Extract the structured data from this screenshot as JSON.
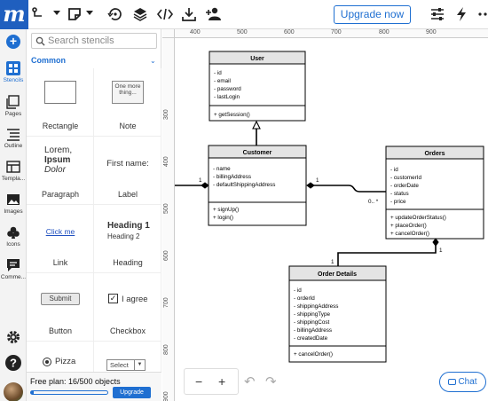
{
  "toolbar": {
    "logo_letter": "m",
    "upgrade_label": "Upgrade now",
    "icons": [
      "logo-icon",
      "connector-icon",
      "note-icon",
      "history-icon",
      "layers-icon",
      "code-icon",
      "download-icon",
      "add-user-icon",
      "settings-sliders-icon",
      "lightning-icon",
      "more-icon"
    ]
  },
  "rail": {
    "items": [
      {
        "label": "Stencils",
        "icon": "stencils-icon"
      },
      {
        "label": "Pages",
        "icon": "pages-icon"
      },
      {
        "label": "Outline",
        "icon": "outline-icon"
      },
      {
        "label": "Templa...",
        "icon": "templates-icon"
      },
      {
        "label": "Images",
        "icon": "images-icon"
      },
      {
        "label": "Icons",
        "icon": "clubs-icon"
      },
      {
        "label": "Comme...",
        "icon": "comments-icon"
      }
    ]
  },
  "stencils": {
    "search_placeholder": "Search stencils",
    "section": "Common",
    "note_text": "One more thing...",
    "paragraph_lines": [
      "Lorem,",
      "Ipsum",
      "Dolor"
    ],
    "label_text": "First name:",
    "link_text": "Click me",
    "heading_1": "Heading 1",
    "heading_2": "Heading 2",
    "button_text": "Submit",
    "checkbox_text": "I agree",
    "radio_text": "Pizza",
    "select_text": "Select",
    "items": [
      "Rectangle",
      "Note",
      "Paragraph",
      "Label",
      "Link",
      "Heading",
      "Button",
      "Checkbox"
    ]
  },
  "plan": {
    "text": "Free plan: 16/500 objects",
    "used_fraction": 0.032,
    "upgrade_label": "Upgrade"
  },
  "ruler": {
    "top": [
      "400",
      "500",
      "600",
      "700",
      "800",
      "900"
    ],
    "left": [
      "300",
      "400",
      "500",
      "600",
      "700",
      "800",
      "900"
    ]
  },
  "diagram": {
    "user": {
      "title": "User",
      "attrs": [
        "- id",
        "- email",
        "- password",
        "- lastLogin"
      ],
      "methods": [
        "+ getSession()"
      ]
    },
    "customer": {
      "title": "Customer",
      "attrs": [
        "- name",
        "- billingAddress",
        "- defaultShippingAddress"
      ],
      "methods": [
        "+ signUp()",
        "+ login()"
      ]
    },
    "orders": {
      "title": "Orders",
      "attrs": [
        "- id",
        "- customerId",
        "- orderDate",
        "- status",
        "- price"
      ],
      "methods": [
        "+ updateOrderStatus()",
        "+ placeOrder()",
        "+ cancelOrder()"
      ]
    },
    "order_details": {
      "title": "Order Details",
      "attrs": [
        "- id",
        "- orderId",
        "- shippingAddress",
        "- shippingType",
        "- shippingCost",
        "- billingAddress",
        "- createdDate"
      ],
      "methods": [
        "+ cancelOrder()"
      ]
    },
    "multiplicities": [
      "1",
      "1",
      "0.. *",
      "1",
      "1"
    ]
  },
  "canvas_controls": {
    "zoom_out": "−",
    "zoom_in": "+",
    "undo": "↶",
    "redo": "↷",
    "chat_label": "Chat"
  }
}
